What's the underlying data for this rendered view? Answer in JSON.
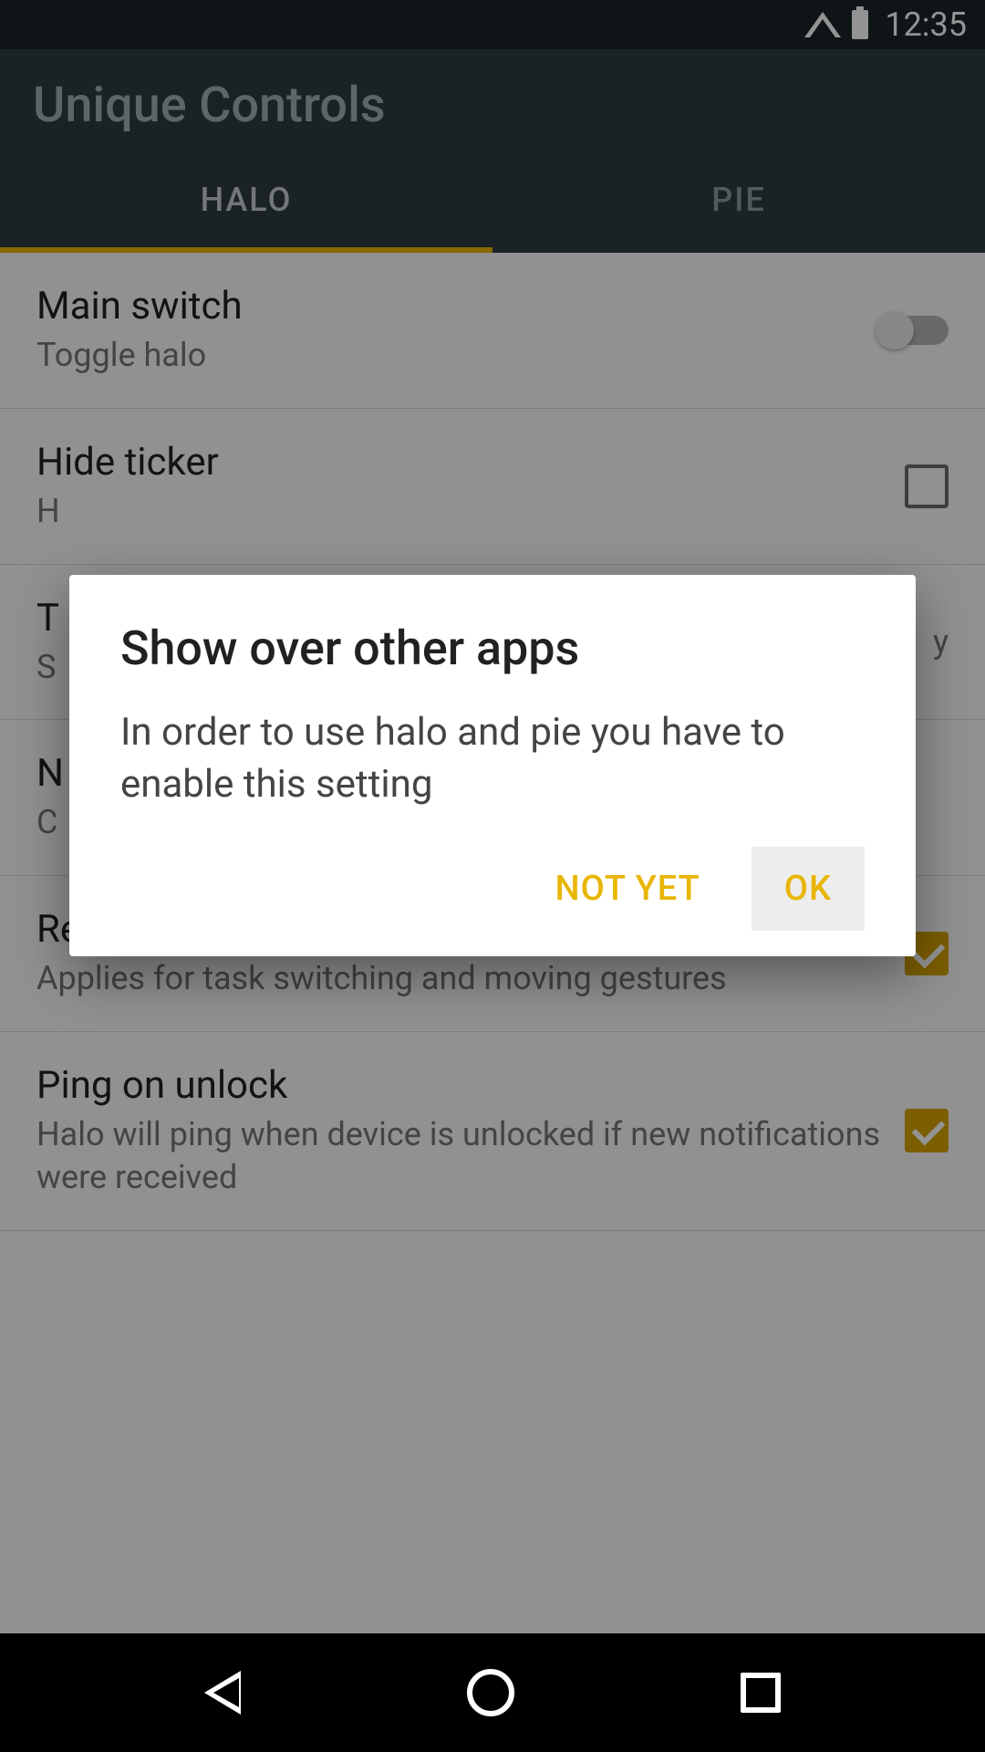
{
  "status": {
    "time": "12:35"
  },
  "app": {
    "title": "Unique Controls"
  },
  "tabs": [
    {
      "label": "HALO",
      "active": true
    },
    {
      "label": "PIE",
      "active": false
    }
  ],
  "items": [
    {
      "title": "Main switch",
      "subtitle": "Toggle halo",
      "control": "switch",
      "checked": false
    },
    {
      "title": "Hide ticker",
      "subtitle": "H",
      "control": "checkbox",
      "checked": false
    },
    {
      "title": "T",
      "subtitle": "S",
      "control": "none",
      "trailing": "y"
    },
    {
      "title": "N",
      "subtitle": "C",
      "control": "none"
    },
    {
      "title": "Reverse gestures",
      "subtitle": "Applies for task switching and moving gestures",
      "control": "checkbox",
      "checked": true
    },
    {
      "title": "Ping on unlock",
      "subtitle": "Halo will ping when device is unlocked if new notifications were received",
      "control": "checkbox",
      "checked": true
    }
  ],
  "dialog": {
    "title": "Show over other apps",
    "body": "In order to use halo and pie you have to enable this setting",
    "negative": "NOT YET",
    "positive": "OK"
  }
}
